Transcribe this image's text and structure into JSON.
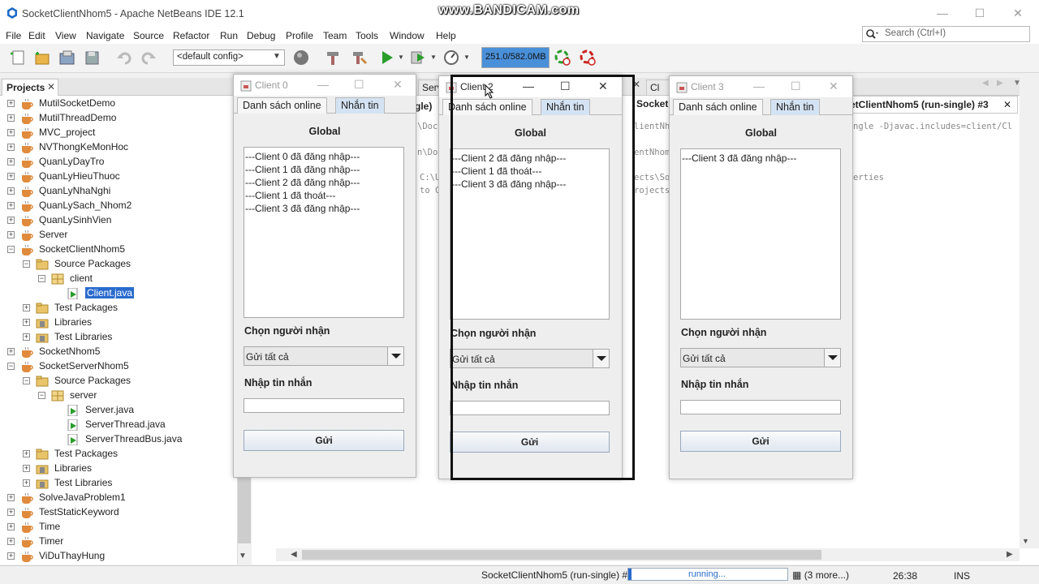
{
  "window": {
    "title": "SocketClientNhom5 - Apache NetBeans IDE 12.1",
    "watermark": "www.BANDICAM.com"
  },
  "menu": [
    "File",
    "Edit",
    "View",
    "Navigate",
    "Source",
    "Refactor",
    "Run",
    "Debug",
    "Profile",
    "Team",
    "Tools",
    "Window",
    "Help"
  ],
  "search": {
    "placeholder": "Search (Ctrl+I)"
  },
  "toolbar": {
    "config": "<default config>",
    "memory": "251.0/582.0MB"
  },
  "projects": {
    "tab_label": "Projects",
    "items": [
      {
        "label": "MutilSocketDemo"
      },
      {
        "label": "MutilThreadDemo"
      },
      {
        "label": "MVC_project"
      },
      {
        "label": "NVThongKeMonHoc"
      },
      {
        "label": "QuanLyDayTro"
      },
      {
        "label": "QuanLyHieuThuoc"
      },
      {
        "label": "QuanLyNhaNghi"
      },
      {
        "label": "QuanLySach_Nhom2"
      },
      {
        "label": "QuanLySinhVien"
      },
      {
        "label": "Server"
      },
      {
        "label": "SocketClientNhom5"
      },
      {
        "label": "Source Packages"
      },
      {
        "label": "client"
      },
      {
        "label": "Client.java"
      },
      {
        "label": "Test Packages"
      },
      {
        "label": "Libraries"
      },
      {
        "label": "Test Libraries"
      },
      {
        "label": "SocketNhom5"
      },
      {
        "label": "SocketServerNhom5"
      },
      {
        "label": "Source Packages"
      },
      {
        "label": "server"
      },
      {
        "label": "Server.java"
      },
      {
        "label": "ServerThread.java"
      },
      {
        "label": "ServerThreadBus.java"
      },
      {
        "label": "Test Packages"
      },
      {
        "label": "Libraries"
      },
      {
        "label": "Test Libraries"
      },
      {
        "label": "SolveJavaProblem1"
      },
      {
        "label": "TestStaticKeyword"
      },
      {
        "label": "Time"
      },
      {
        "label": "Timer"
      },
      {
        "label": "ViDuThayHung"
      }
    ]
  },
  "editor": {
    "tab_fragments": [
      "Serv",
      "Cl",
      "Socket",
      "gle)"
    ],
    "output_tab": "etClientNhom5 (run-single) #3",
    "output_lines": [
      "\\Doc",
      "lientNhom",
      "ngle -Djavac.includes=client/Cl",
      "n\\Doc",
      "entNhom5\\",
      "C:\\U",
      "ects\\Sock",
      "erties",
      "to C",
      "rojects\\S"
    ]
  },
  "status": {
    "task": "SocketClientNhom5 (run-single) #2",
    "progress_text": "running...",
    "more": "(3 more...)",
    "time": "26:38",
    "mode": "INS"
  },
  "clients": [
    {
      "title": "Client 0",
      "tab_online": "Danh sách online",
      "tab_message": "Nhắn tin",
      "heading": "Global",
      "log": [
        "---Client 0 đã đăng nhập---",
        "---Client 1 đã đăng nhập---",
        "---Client 2 đã đăng nhập---",
        "---Client 1 đã thoát---",
        "---Client 3 đã đăng nhập---"
      ],
      "recipient_label": "Chọn người nhận",
      "recipient_value": "Gửi tất cả",
      "message_label": "Nhập tin nhắn",
      "message_value": "",
      "send_label": "Gửi"
    },
    {
      "title": "Client 2",
      "tab_online": "Danh sách online",
      "tab_message": "Nhắn tin",
      "heading": "Global",
      "log": [
        "---Client 2 đã đăng nhập---",
        "---Client 1 đã thoát---",
        "---Client 3 đã đăng nhập---"
      ],
      "recipient_label": "Chọn người nhận",
      "recipient_value": "Gửi tất cả",
      "message_label": "Nhập tin nhắn",
      "message_value": "",
      "send_label": "Gửi"
    },
    {
      "title": "Client 3",
      "tab_online": "Danh sách online",
      "tab_message": "Nhắn tin",
      "heading": "Global",
      "log": [
        "---Client 3 đã đăng nhập---"
      ],
      "recipient_label": "Chọn người nhận",
      "recipient_value": "Gửi tất cả",
      "message_label": "Nhập tin nhắn",
      "message_value": "",
      "send_label": "Gửi"
    }
  ]
}
